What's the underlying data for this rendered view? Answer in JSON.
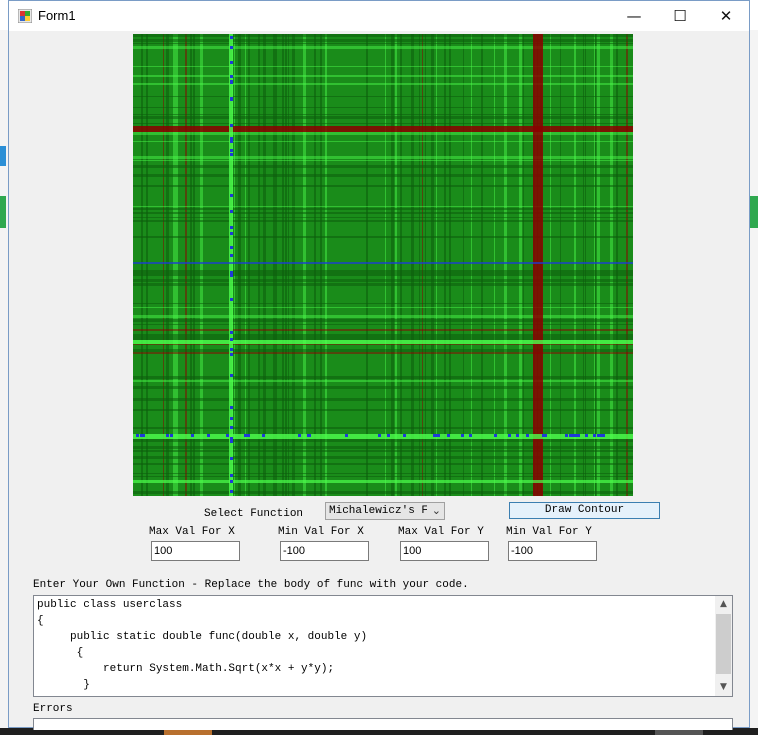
{
  "window": {
    "title": "Form1",
    "minimize_glyph": "—",
    "maximize_glyph": "☐",
    "close_glyph": "✕"
  },
  "contour": {
    "colors": {
      "base": "#1a8c1a",
      "dark": "#0d5c0d",
      "red": "#8b0000",
      "bright": "#4dff4d",
      "blue": "#1e3ad8"
    }
  },
  "controls": {
    "select_function_label": "Select Function",
    "function_combo_value": "Michalewicz's Fu",
    "draw_button": "Draw Contour",
    "max_x_label": "Max Val For X",
    "min_x_label": "Min Val For X",
    "max_y_label": "Max Val For Y",
    "min_y_label": "Min Val For Y",
    "max_x_value": "100",
    "min_x_value": "-100",
    "max_y_value": "100",
    "min_y_value": "-100"
  },
  "code": {
    "label": "Enter Your Own Function - Replace the body of func with your code.",
    "lines": [
      "public class userclass",
      "{",
      "     public static double func(double x, double y)",
      "      {",
      "          return System.Math.Sqrt(x*x + y*y);",
      "       }"
    ]
  },
  "errors": {
    "label": "Errors"
  }
}
